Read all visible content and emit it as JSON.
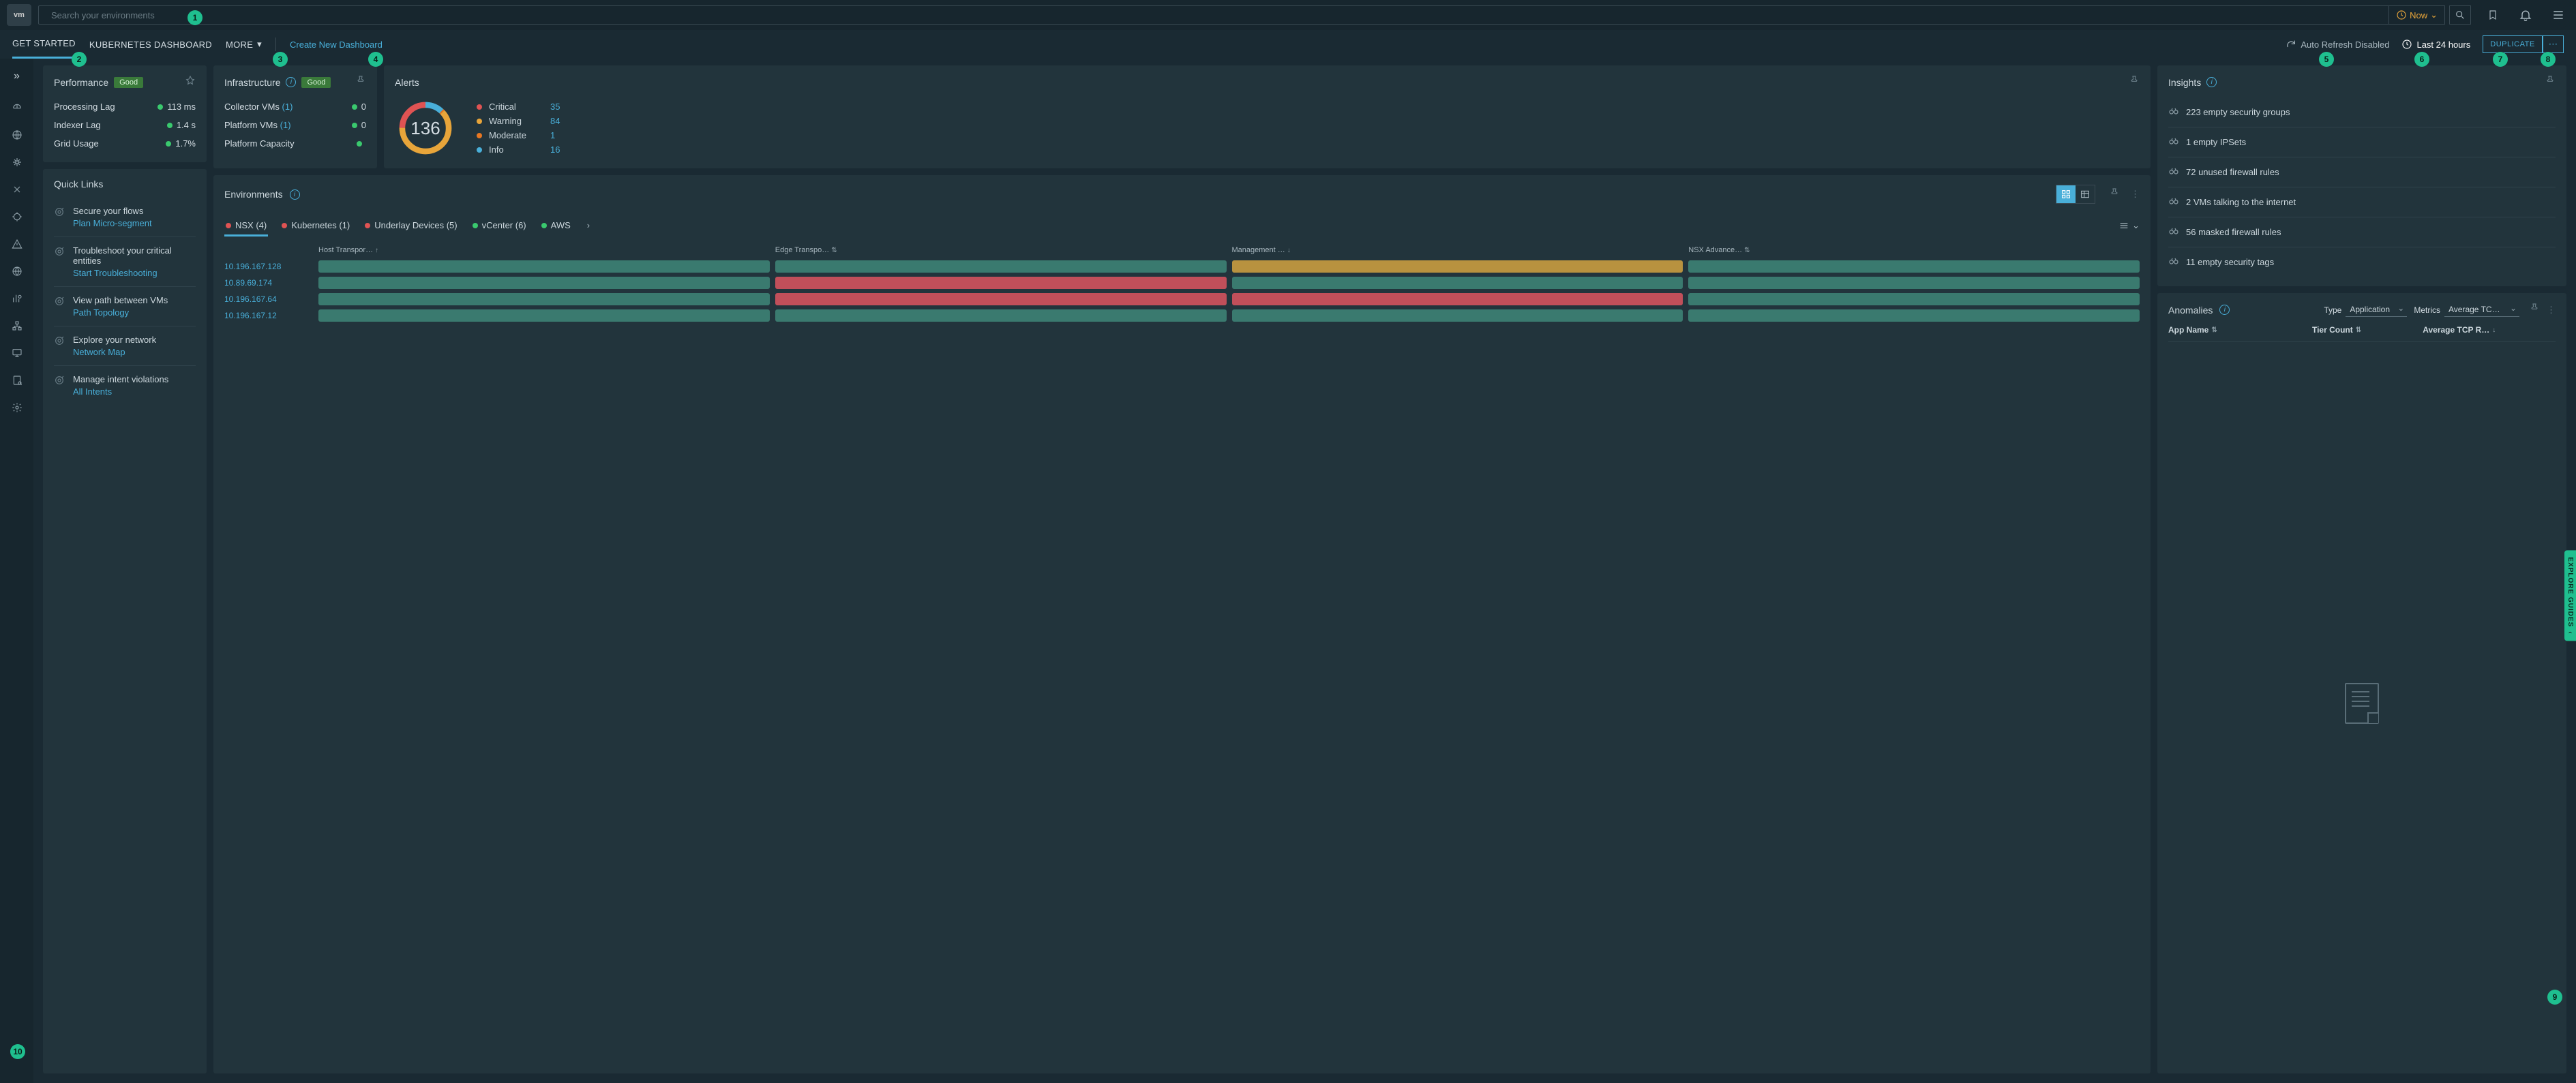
{
  "search": {
    "placeholder": "Search your environments"
  },
  "now_label": "Now",
  "tabs": {
    "get_started": "GET STARTED",
    "kubernetes": "KUBERNETES DASHBOARD",
    "more": "MORE",
    "create": "Create New Dashboard"
  },
  "top_right": {
    "auto_refresh": "Auto Refresh Disabled",
    "timerange": "Last 24 hours",
    "duplicate": "DUPLICATE"
  },
  "performance": {
    "title": "Performance",
    "status": "Good",
    "metrics": [
      {
        "label": "Processing Lag",
        "value": "113 ms"
      },
      {
        "label": "Indexer Lag",
        "value": "1.4 s"
      },
      {
        "label": "Grid Usage",
        "value": "1.7%"
      }
    ]
  },
  "infrastructure": {
    "title": "Infrastructure",
    "status": "Good",
    "metrics": [
      {
        "label": "Collector VMs",
        "count": "(1)",
        "value": "0"
      },
      {
        "label": "Platform VMs",
        "count": "(1)",
        "value": "0"
      },
      {
        "label": "Platform Capacity",
        "count": "",
        "value": ""
      }
    ]
  },
  "alerts": {
    "title": "Alerts",
    "total": "136",
    "items": [
      {
        "label": "Critical",
        "count": "35",
        "color": "#e05353"
      },
      {
        "label": "Warning",
        "count": "84",
        "color": "#e8a53a"
      },
      {
        "label": "Moderate",
        "count": "1",
        "color": "#e87722"
      },
      {
        "label": "Info",
        "count": "16",
        "color": "#49afd9"
      }
    ]
  },
  "quicklinks": {
    "title": "Quick Links",
    "items": [
      {
        "title": "Secure your flows",
        "link": "Plan Micro-segment"
      },
      {
        "title": "Troubleshoot your critical entities",
        "link": "Start Troubleshooting"
      },
      {
        "title": "View path between VMs",
        "link": "Path Topology"
      },
      {
        "title": "Explore your network",
        "link": "Network Map"
      },
      {
        "title": "Manage intent violations",
        "link": "All Intents"
      }
    ]
  },
  "environments": {
    "title": "Environments",
    "tabs": [
      {
        "label": "NSX (4)",
        "dot": "#e05353",
        "active": true
      },
      {
        "label": "Kubernetes (1)",
        "dot": "#e05353"
      },
      {
        "label": "Underlay Devices (5)",
        "dot": "#e05353"
      },
      {
        "label": "vCenter (6)",
        "dot": "#3ac96e"
      },
      {
        "label": "AWS",
        "dot": "#3ac96e"
      }
    ],
    "columns": [
      "Host Transpor…",
      "Edge Transpo…",
      "Management …",
      "NSX Advance…"
    ],
    "rows": [
      {
        "ip": "10.196.167.128",
        "cells": [
          "green",
          "green",
          "yellow",
          "green"
        ]
      },
      {
        "ip": "10.89.69.174",
        "cells": [
          "green",
          "red",
          "green",
          "green"
        ]
      },
      {
        "ip": "10.196.167.64",
        "cells": [
          "green",
          "red",
          "red",
          "green"
        ]
      },
      {
        "ip": "10.196.167.12",
        "cells": [
          "green",
          "green",
          "green",
          "green"
        ]
      }
    ]
  },
  "insights": {
    "title": "Insights",
    "items": [
      "223 empty security groups",
      "1 empty IPSets",
      "72 unused firewall rules",
      "2 VMs talking to the internet",
      "56 masked firewall rules",
      "11 empty security tags"
    ]
  },
  "anomalies": {
    "title": "Anomalies",
    "type_label": "Type",
    "type_value": "Application",
    "metrics_label": "Metrics",
    "metrics_value": "Average TC…",
    "columns": [
      "App Name",
      "Tier Count",
      "Average TCP R…"
    ]
  },
  "explore_guides": "EXPLORE GUIDES",
  "annotations": [
    "1",
    "2",
    "3",
    "4",
    "5",
    "6",
    "7",
    "8",
    "9",
    "10"
  ]
}
